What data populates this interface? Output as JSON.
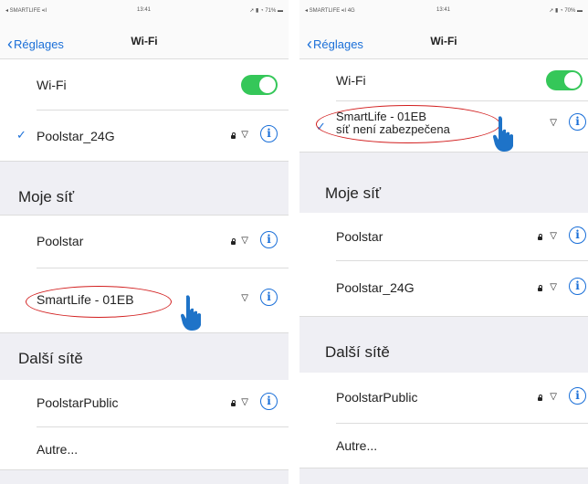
{
  "left": {
    "status": {
      "carrier": "◂ SMARTLIFE ▪ıl",
      "time": "13:41",
      "right": "➚ ▮ ◔ 71% ▬"
    },
    "nav": {
      "back_label": "Réglages",
      "title": "Wi-Fi"
    },
    "wifi_row": {
      "label": "Wi-Fi"
    },
    "connected": {
      "label": "Poolstar_24G"
    },
    "section_my": {
      "title": "Moje síť"
    },
    "my_networks": [
      {
        "label": "Poolstar"
      },
      {
        "label": "SmartLife - 01EB"
      }
    ],
    "section_other": {
      "title": "Další sítě"
    },
    "other_networks": [
      {
        "label": "PoolstarPublic"
      },
      {
        "label": "Autre..."
      }
    ]
  },
  "right": {
    "status": {
      "carrier": "◂ SMARTLIFE ▪ıl 4G",
      "time": "13:41",
      "right": "➚ ▮ ◔ 70% ▬"
    },
    "nav": {
      "back_label": "Réglages",
      "title": "Wi-Fi"
    },
    "wifi_row": {
      "label": "Wi-Fi"
    },
    "connected": {
      "label": "SmartLife - 01EB",
      "sublabel": "síť není zabezpečena"
    },
    "section_my": {
      "title": "Moje síť"
    },
    "my_networks": [
      {
        "label": "Poolstar"
      },
      {
        "label": "Poolstar_24G"
      }
    ],
    "section_other": {
      "title": "Další sítě"
    },
    "other_networks": [
      {
        "label": "PoolstarPublic"
      },
      {
        "label": "Autre..."
      }
    ]
  },
  "icons": {
    "check": "checkmark-icon",
    "lock": "lock-icon",
    "wifi": "wifi-icon",
    "info": "info-icon",
    "hand": "pointing-hand-icon"
  },
  "colors": {
    "accent": "#1a6fd8",
    "toggle_on": "#35c759",
    "highlight": "#d21e1e",
    "group_bg": "#efeff4"
  }
}
